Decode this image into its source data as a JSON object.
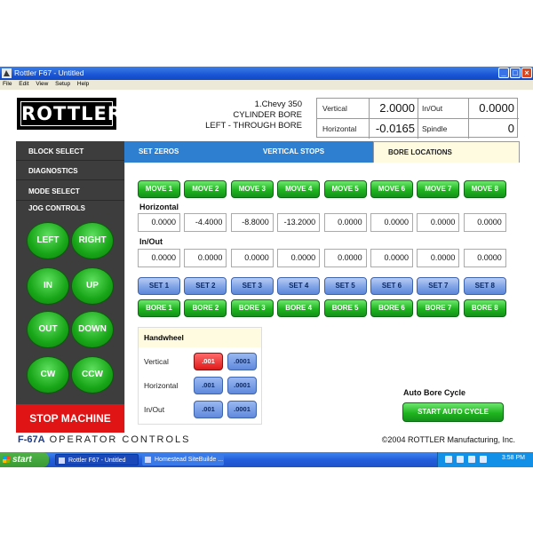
{
  "window": {
    "title": "Rottler F67 - Untitled"
  },
  "menu": [
    "File",
    "Edit",
    "View",
    "Setup",
    "Help"
  ],
  "logo_text": "ROTTLER",
  "job": {
    "line1": "1.Chevy 350",
    "line2": "CYLINDER BORE",
    "line3": "LEFT - THROUGH BORE"
  },
  "readout": {
    "vertical_label": "Vertical",
    "vertical_value": "2.0000",
    "horizontal_label": "Horizontal",
    "horizontal_value": "-0.0165",
    "inout_label": "In/Out",
    "inout_value": "0.0000",
    "spindle_label": "Spindle",
    "spindle_value": "0"
  },
  "nav": [
    "BLOCK SELECT",
    "DIAGNOSTICS",
    "MODE SELECT",
    "JOG CONTROLS"
  ],
  "jog": {
    "left": "LEFT",
    "right": "RIGHT",
    "in": "IN",
    "up": "UP",
    "out": "OUT",
    "down": "DOWN",
    "cw": "CW",
    "ccw": "CCW"
  },
  "stop_label": "STOP MACHINE",
  "tabs": [
    "SET ZEROS",
    "VERTICAL STOPS",
    "BORE LOCATIONS"
  ],
  "active_tab": "BORE LOCATIONS",
  "move_buttons": [
    "MOVE 1",
    "MOVE 2",
    "MOVE 3",
    "MOVE 4",
    "MOVE 5",
    "MOVE 6",
    "MOVE 7",
    "MOVE 8"
  ],
  "horizontal_label": "Horizontal",
  "horizontal_values": [
    "0.0000",
    "-4.4000",
    "-8.8000",
    "-13.2000",
    "0.0000",
    "0.0000",
    "0.0000",
    "0.0000"
  ],
  "inout_label": "In/Out",
  "inout_values": [
    "0.0000",
    "0.0000",
    "0.0000",
    "0.0000",
    "0.0000",
    "0.0000",
    "0.0000",
    "0.0000"
  ],
  "set_buttons": [
    "SET 1",
    "SET 2",
    "SET 3",
    "SET 4",
    "SET 5",
    "SET 6",
    "SET 7",
    "SET 8"
  ],
  "bore_buttons": [
    "BORE 1",
    "BORE 2",
    "BORE 3",
    "BORE 4",
    "BORE 5",
    "BORE 6",
    "BORE 7",
    "BORE 8"
  ],
  "handwheel": {
    "title": "Handwheel",
    "rows": [
      {
        "label": "Vertical",
        "coarse": ".001",
        "fine": ".0001",
        "selected": "coarse"
      },
      {
        "label": "Horizontal",
        "coarse": ".001",
        "fine": ".0001",
        "selected": "none"
      },
      {
        "label": "In/Out",
        "coarse": ".001",
        "fine": ".0001",
        "selected": "none"
      }
    ]
  },
  "auto_bore": {
    "label": "Auto Bore Cycle",
    "button": "START AUTO CYCLE"
  },
  "footer": {
    "model": "F-67A",
    "controls": "OPERATOR CONTROLS",
    "copyright": "©2004 ROTTLER Manufacturing, Inc."
  },
  "taskbar": {
    "start": "start",
    "items": [
      "Rottler F67 - Untitled",
      "Homestead SiteBuilde ..."
    ],
    "clock": "3:58 PM"
  },
  "colors": {
    "accent_blue": "#2f7fd1",
    "stop_red": "#e01414",
    "go_green": "#1fb51f",
    "panel_dark": "#3d3d3d"
  }
}
